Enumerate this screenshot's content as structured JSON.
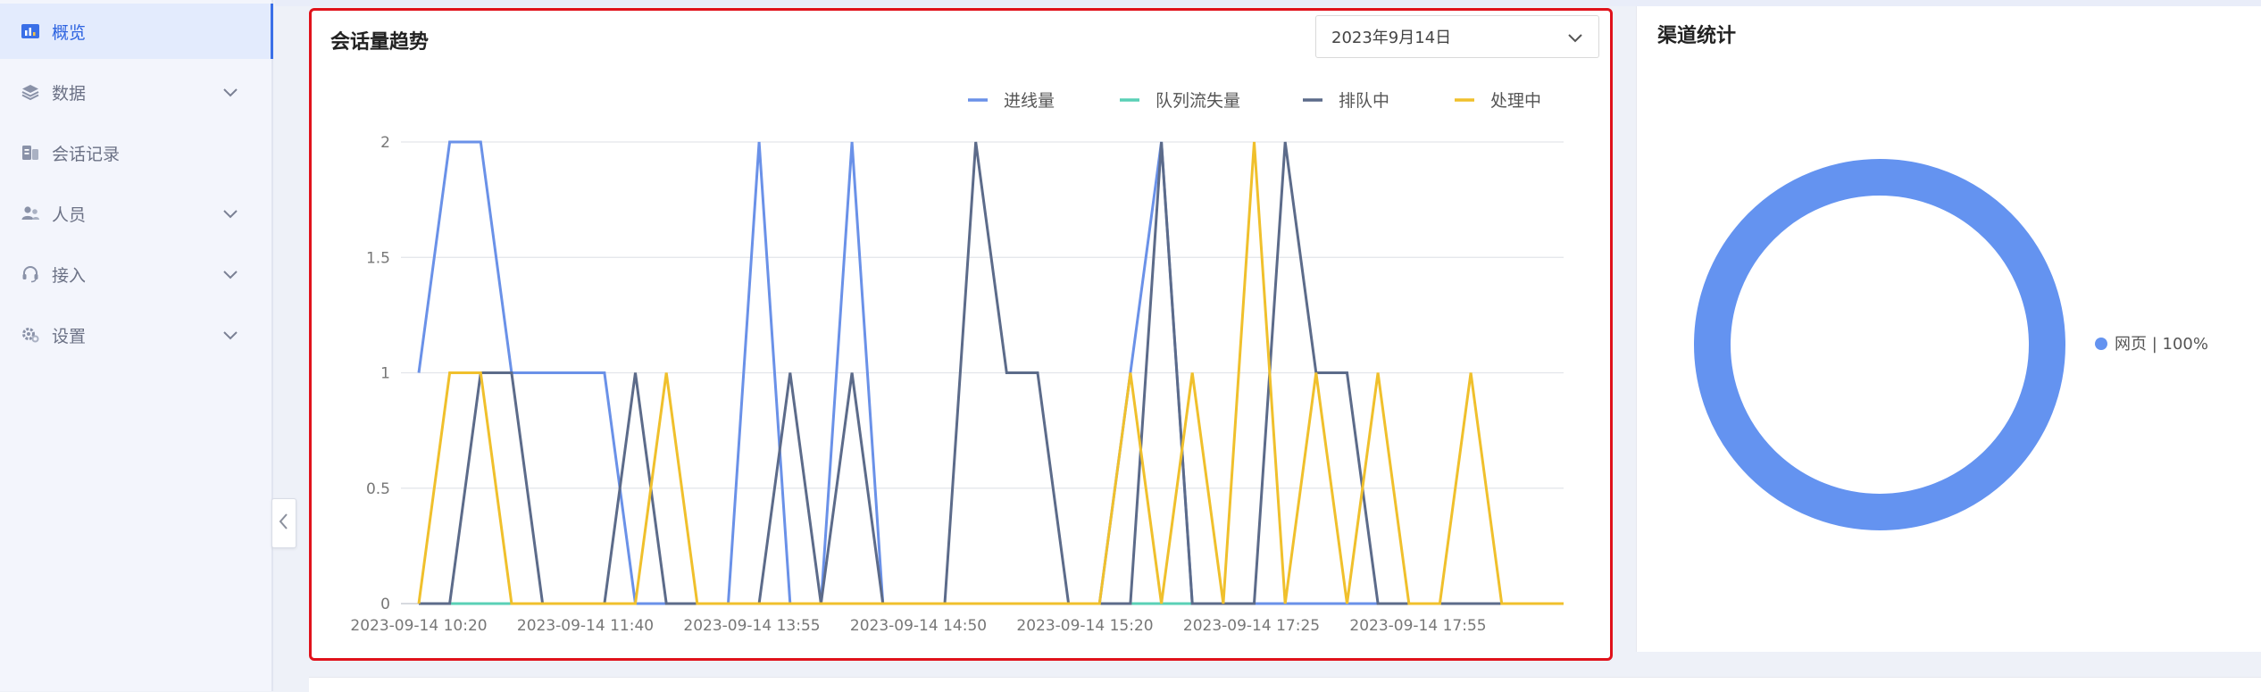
{
  "sidebar": {
    "items": [
      {
        "label": "概览",
        "icon": "overview-icon"
      },
      {
        "label": "数据",
        "icon": "data-layers-icon"
      },
      {
        "label": "会话记录",
        "icon": "session-record-icon"
      },
      {
        "label": "人员",
        "icon": "people-icon"
      },
      {
        "label": "接入",
        "icon": "headset-icon"
      },
      {
        "label": "设置",
        "icon": "gear-icon"
      }
    ]
  },
  "trend_card": {
    "title": "会话量趋势",
    "date_value": "2023年9月14日"
  },
  "channel_card": {
    "title": "渠道统计"
  },
  "colors": {
    "accent": "#3a6fe7",
    "highlight_border": "#e0121b",
    "series_incoming": "#6a91e8",
    "series_lost": "#5ad0b6",
    "series_queue": "#5c6b8a",
    "series_handling": "#f0c02c",
    "donut": "#6493f0"
  },
  "chart_data": [
    {
      "type": "line",
      "x": [
        "2023-09-14 10:20",
        "",
        "",
        "",
        "",
        "2023-09-14 11:40",
        "",
        "",
        "",
        "",
        "2023-09-14 13:55",
        "",
        "",
        "",
        "",
        "2023-09-14 14:50",
        "",
        "",
        "",
        "",
        "2023-09-14 15:20",
        "",
        "",
        "",
        "",
        "2023-09-14 17:25",
        "",
        "",
        "",
        "",
        "2023-09-14 17:55",
        "",
        "",
        "",
        ""
      ],
      "xtick_labels": [
        "2023-09-14 10:20",
        "2023-09-14 11:40",
        "2023-09-14 13:55",
        "2023-09-14 14:50",
        "2023-09-14 15:20",
        "2023-09-14 17:25",
        "2023-09-14 17:55"
      ],
      "yticks": [
        "0",
        "0.5",
        "1",
        "1.5",
        "2"
      ],
      "ylim": [
        0,
        2
      ],
      "grid": true,
      "legend_position": "top-right",
      "series": [
        {
          "name": "进线量",
          "values": [
            1,
            2,
            2,
            1,
            1,
            1,
            1,
            0,
            0,
            0,
            0,
            2,
            0,
            0,
            2,
            0,
            0,
            0,
            0,
            0,
            0,
            0,
            0,
            1,
            2,
            0,
            0,
            0,
            0,
            0,
            0,
            0,
            0,
            0,
            0,
            0,
            0,
            0
          ]
        },
        {
          "name": "队列流失量",
          "values": [
            0,
            0,
            0,
            0,
            0,
            0,
            0,
            0,
            0,
            0,
            0,
            0,
            0,
            0,
            0,
            0,
            0,
            0,
            0,
            0,
            0,
            0,
            0,
            0,
            0,
            0,
            0,
            0,
            0,
            0,
            0,
            0,
            0,
            0,
            0,
            0,
            0,
            0
          ]
        },
        {
          "name": "排队中",
          "values": [
            0,
            0,
            1,
            1,
            0,
            0,
            0,
            1,
            0,
            0,
            0,
            0,
            1,
            0,
            1,
            0,
            0,
            0,
            2,
            1,
            1,
            0,
            0,
            0,
            2,
            0,
            0,
            0,
            2,
            1,
            1,
            0,
            0,
            0,
            0,
            0,
            0,
            0
          ]
        },
        {
          "name": "处理中",
          "values": [
            0,
            1,
            1,
            0,
            0,
            0,
            0,
            0,
            1,
            0,
            0,
            0,
            0,
            0,
            0,
            0,
            0,
            0,
            0,
            0,
            0,
            0,
            0,
            1,
            0,
            1,
            0,
            2,
            0,
            1,
            0,
            1,
            0,
            0,
            1,
            0,
            0,
            0
          ]
        }
      ]
    },
    {
      "type": "pie",
      "categories": [
        "网页"
      ],
      "values": [
        100
      ],
      "legend_label": "网页  |  100%",
      "legend_position": "right"
    }
  ]
}
